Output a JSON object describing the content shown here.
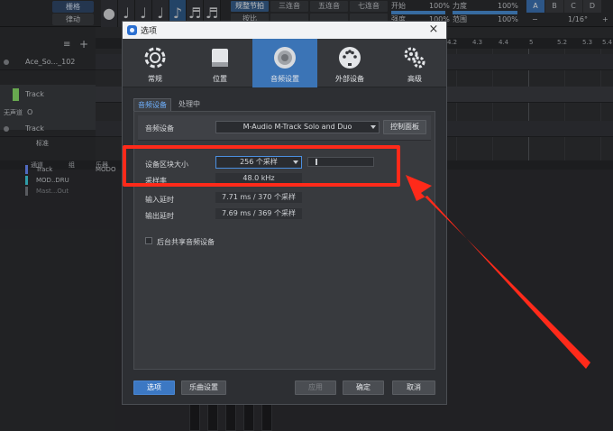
{
  "daw": {
    "toolbar": {
      "grid_btn": "栅格",
      "groove_btn": "律动",
      "modes": [
        "规整节拍",
        "三连音",
        "五连音",
        "七连音"
      ],
      "sub_modes": [
        "按比",
        "",
        "",
        ""
      ],
      "start_label": "开始",
      "start_value": "100%",
      "velocity_label": "力度",
      "velocity_value": "100%",
      "strength_label": "强度",
      "strength_value": "100%",
      "range_label": "范围",
      "range_value": "100%",
      "letters": [
        "A",
        "B",
        "C",
        "D"
      ],
      "quantize_value": "1/16°",
      "minus": "−",
      "plus": "+"
    },
    "tracks": [
      {
        "name": "Ace_So..._102"
      },
      {
        "name": "Track"
      },
      {
        "name": "Track"
      }
    ],
    "track_panel": {
      "input_label": "无声道",
      "extra": "O"
    },
    "ruler_ticks": [
      "4.2",
      "4.3",
      "4.4",
      "5",
      "5.2",
      "5.3",
      "5.4"
    ],
    "view_label": "标准",
    "console": {
      "col_channel": "通道",
      "col_group": "组",
      "col_instrument": "乐器",
      "instrument_value": "MODO",
      "channels": [
        {
          "name": "Track",
          "color": "#6a8cff"
        },
        {
          "name": "MOD..DRU",
          "color": "#3fd0e0"
        },
        {
          "name": "Mast...Out",
          "color": "#777a80"
        }
      ]
    }
  },
  "dialog": {
    "title": "选项",
    "close_glyph": "×",
    "categories": [
      {
        "label": "常规",
        "icon": "gear-icon"
      },
      {
        "label": "位置",
        "icon": "drive-icon"
      },
      {
        "label": "音频设置",
        "icon": "speaker-icon",
        "active": true
      },
      {
        "label": "外部设备",
        "icon": "midi-icon"
      },
      {
        "label": "高级",
        "icon": "gears-icon"
      }
    ],
    "tabs": [
      "音频设备",
      "处理中"
    ],
    "audio_device_label": "音频设备",
    "audio_device_value": "M-Audio M-Track Solo and Duo",
    "control_panel_button": "控制面板",
    "block_size_label": "设备区块大小",
    "block_size_value": "256 个采样",
    "sample_rate_label": "采样率",
    "sample_rate_value": "48.0 kHz",
    "input_latency_label": "输入延时",
    "input_latency_value": "7.71 ms / 370 个采样",
    "output_latency_label": "输出延时",
    "output_latency_value": "7.69 ms / 369 个采样",
    "background_share_label": "后台共享音频设备",
    "footer": {
      "options": "选项",
      "song_settings": "乐曲设置",
      "apply": "应用",
      "ok": "确定",
      "cancel": "取消"
    }
  },
  "annotation": {
    "highlight_color": "#ff2a1a"
  }
}
